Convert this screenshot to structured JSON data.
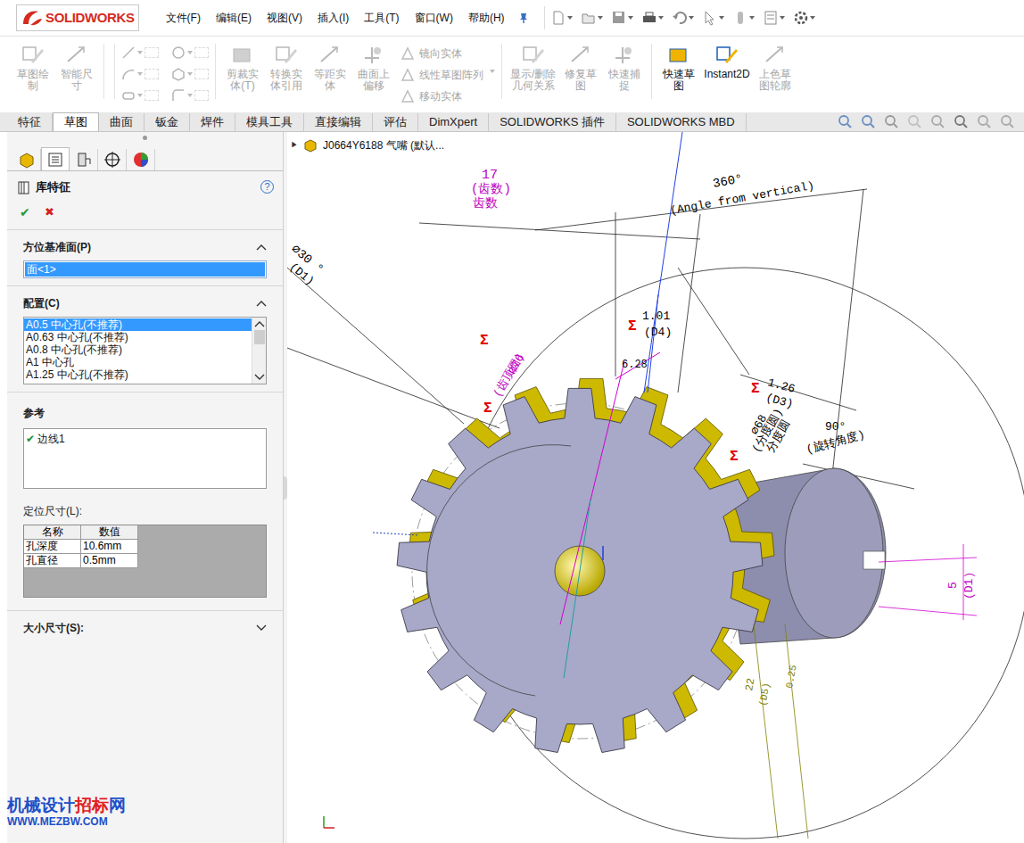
{
  "app": {
    "logo": "SOLIDWORKS"
  },
  "menus": [
    "文件(F)",
    "编辑(E)",
    "视图(V)",
    "插入(I)",
    "工具(T)",
    "窗口(W)",
    "帮助(H)"
  ],
  "ribbon": [
    {
      "kind": "big",
      "lines": [
        "草图绘",
        "制"
      ],
      "disabled": true
    },
    {
      "kind": "big",
      "lines": [
        "智能尺",
        "寸"
      ],
      "disabled": true
    },
    {
      "kind": "grid",
      "disabled": true
    },
    {
      "kind": "big",
      "lines": [
        "剪裁实",
        "体(T)"
      ],
      "disabled": true
    },
    {
      "kind": "big",
      "lines": [
        "转换实",
        "体引用"
      ],
      "disabled": true
    },
    {
      "kind": "big",
      "lines": [
        "等距实",
        "体"
      ],
      "disabled": true
    },
    {
      "kind": "big",
      "lines": [
        "曲面上",
        "偏移"
      ],
      "disabled": true
    },
    {
      "kind": "list",
      "items": [
        {
          "label": "镜向实体",
          "disabled": true
        },
        {
          "label": "线性草图阵列",
          "disabled": true
        },
        {
          "label": "移动实体",
          "disabled": true
        }
      ]
    },
    {
      "kind": "big",
      "lines": [
        "显示/删除",
        "几何关系"
      ],
      "disabled": true
    },
    {
      "kind": "big",
      "lines": [
        "修复草",
        "图"
      ],
      "disabled": true
    },
    {
      "kind": "big",
      "lines": [
        "快速捕",
        "捉"
      ],
      "disabled": true
    },
    {
      "kind": "big",
      "lines": [
        "快速草",
        "图"
      ],
      "disabled": false
    },
    {
      "kind": "big",
      "lines": [
        "Instant2D"
      ],
      "disabled": false
    },
    {
      "kind": "big",
      "lines": [
        "上色草",
        "图轮廓"
      ],
      "disabled": true
    }
  ],
  "tabs": [
    {
      "label": "特征",
      "selected": false
    },
    {
      "label": "草图",
      "selected": true
    },
    {
      "label": "曲面",
      "selected": false
    },
    {
      "label": "钣金",
      "selected": false
    },
    {
      "label": "焊件",
      "selected": false
    },
    {
      "label": "模具工具",
      "selected": false
    },
    {
      "label": "直接编辑",
      "selected": false
    },
    {
      "label": "评估",
      "selected": false
    },
    {
      "label": "DimXpert",
      "selected": false
    },
    {
      "label": "SOLIDWORKS 插件",
      "selected": false
    },
    {
      "label": "SOLIDWORKS MBD",
      "selected": false
    }
  ],
  "panel": {
    "tabs": [
      {
        "selected": false
      },
      {
        "selected": true
      },
      {
        "selected": false
      },
      {
        "selected": false
      },
      {
        "selected": false
      }
    ],
    "title": "库特征",
    "help": "?",
    "ok": "✔",
    "cancel": "✖",
    "orientation": {
      "label": "方位基准面(P)",
      "value": "面<1>",
      "expanded": true
    },
    "config": {
      "label": "配置(C)",
      "expanded": true,
      "items": [
        {
          "label": "A0.5 中心孔(不推荐)",
          "selected": true
        },
        {
          "label": "A0.63 中心孔(不推荐)",
          "selected": false
        },
        {
          "label": "A0.8 中心孔(不推荐)",
          "selected": false
        },
        {
          "label": "A1 中心孔",
          "selected": false
        },
        {
          "label": "A1.25 中心孔(不推荐)",
          "selected": false
        }
      ]
    },
    "reference": {
      "label": "参考",
      "items": [
        {
          "label": "边线1",
          "check": "✔"
        }
      ]
    },
    "locate": {
      "label": "定位尺寸(L):",
      "columns": [
        "名称",
        "数值"
      ],
      "rows": [
        [
          "孔深度",
          "10.6mm"
        ],
        [
          "孔直径",
          "0.5mm"
        ]
      ]
    },
    "size": {
      "label": "大小尺寸(S):",
      "expanded": false
    }
  },
  "viewport": {
    "breadcrumb_arrow": "▶",
    "breadcrumb": "J0664Y6188 气嘴 (默认...",
    "gear": {
      "teeth": 17
    },
    "annotations": [
      {
        "text": "17",
        "color": "#c000c0"
      },
      {
        "text": "(齿数)",
        "color": "#c000c0"
      },
      {
        "text": "齿数",
        "color": "#c000c0"
      },
      {
        "text": "360°",
        "color": "#000000"
      },
      {
        "text": "(Angle from vertical)",
        "color": "#000000"
      },
      {
        "text": "⌀30 °",
        "color": "#000000"
      },
      {
        "text": "(D1)",
        "color": "#000000"
      },
      {
        "text": "Σ",
        "color": "#e00000"
      },
      {
        "text": "1.01",
        "color": "#000000"
      },
      {
        "text": "(D4)",
        "color": "#000000"
      },
      {
        "text": "Σ",
        "color": "#e00000"
      },
      {
        "text": "⌀76",
        "color": "#c000c0"
      },
      {
        "text": "(齿顶圆)",
        "color": "#c000c0"
      },
      {
        "text": "Σ",
        "color": "#e00000"
      },
      {
        "text": "6.28",
        "color": "#000000"
      },
      {
        "text": "Σ",
        "color": "#e00000"
      },
      {
        "text": "1.26",
        "color": "#000000"
      },
      {
        "text": "(D3)",
        "color": "#000000"
      },
      {
        "text": "⌀68",
        "color": "#000000"
      },
      {
        "text": "(分度圆)",
        "color": "#000000"
      },
      {
        "text": "分度圆",
        "color": "#000000"
      },
      {
        "text": "Σ",
        "color": "#e00000"
      },
      {
        "text": "90°",
        "color": "#000000"
      },
      {
        "text": "(旋转角度)",
        "color": "#000000"
      },
      {
        "text": "5",
        "color": "#c000c0"
      },
      {
        "text": "(D1)",
        "color": "#c000c0"
      },
      {
        "text": "22",
        "color": "#808000"
      },
      {
        "text": "0.25",
        "color": "#808000"
      },
      {
        "text": "(D5)",
        "color": "#808000"
      }
    ]
  },
  "watermark": {
    "parts": [
      {
        "text": "机械设计",
        "color": "#1e50c8"
      },
      {
        "text": "招标",
        "color": "#e02020"
      },
      {
        "text": "网",
        "color": "#1e50c8"
      }
    ],
    "url": "WWW.MEZBW.COM"
  }
}
